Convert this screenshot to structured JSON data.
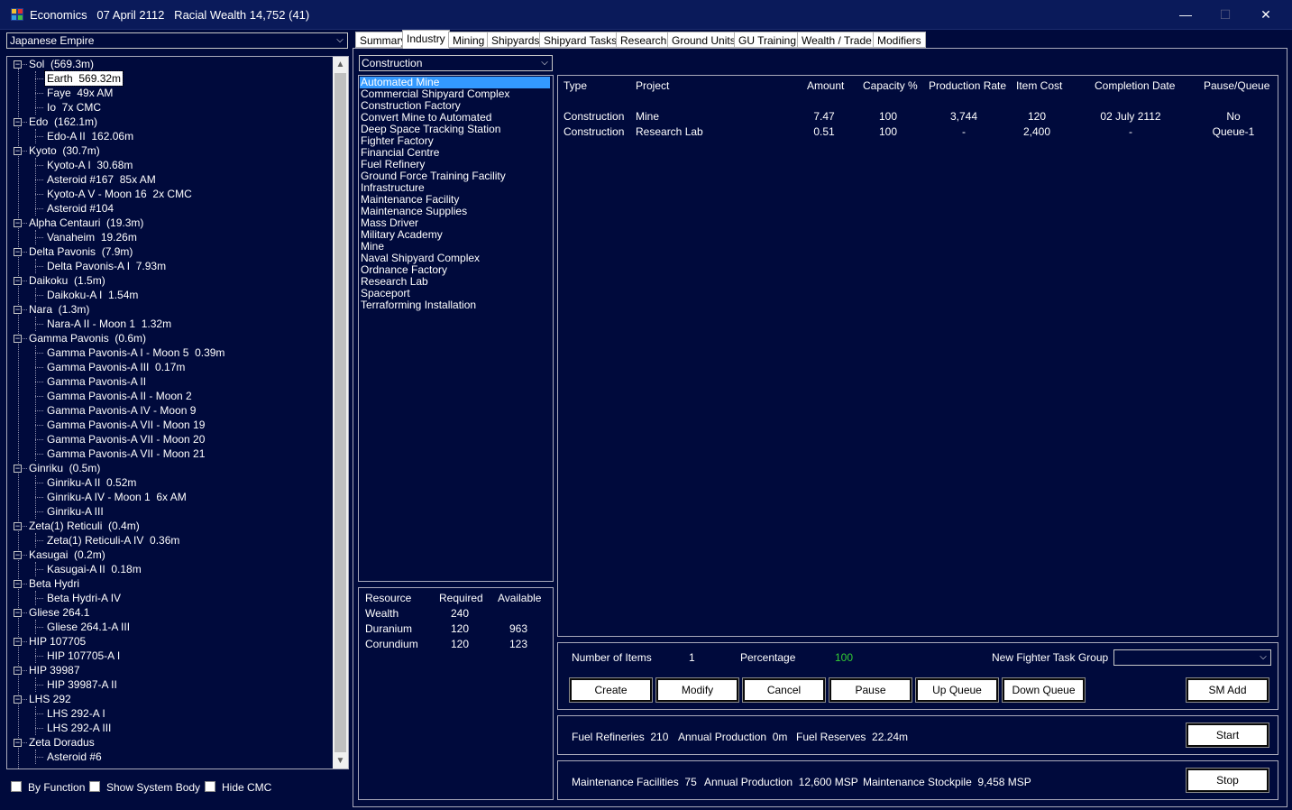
{
  "window": {
    "title": "Economics   07 April 2112   Racial Wealth 14,752 (41)",
    "minimize_glyph": "—",
    "maximize_glyph": "☐",
    "close_glyph": "✕"
  },
  "left": {
    "empire_select_value": "Japanese Empire",
    "tree": [
      {
        "label": "Sol  (569.3m)",
        "children": [
          "Earth  569.32m",
          "Faye  49x AM",
          "Io  7x CMC"
        ]
      },
      {
        "label": "Edo  (162.1m)",
        "children": [
          "Edo-A II  162.06m"
        ]
      },
      {
        "label": "Kyoto  (30.7m)",
        "children": [
          "Kyoto-A I  30.68m",
          "Asteroid #167  85x AM",
          "Kyoto-A V - Moon 16  2x CMC",
          "Asteroid #104"
        ]
      },
      {
        "label": "Alpha Centauri  (19.3m)",
        "children": [
          "Vanaheim  19.26m"
        ]
      },
      {
        "label": "Delta Pavonis  (7.9m)",
        "children": [
          "Delta Pavonis-A I  7.93m"
        ]
      },
      {
        "label": "Daikoku  (1.5m)",
        "children": [
          "Daikoku-A I  1.54m"
        ]
      },
      {
        "label": "Nara  (1.3m)",
        "children": [
          "Nara-A II - Moon 1  1.32m"
        ]
      },
      {
        "label": "Gamma Pavonis  (0.6m)",
        "children": [
          "Gamma Pavonis-A I - Moon 5  0.39m",
          "Gamma Pavonis-A III  0.17m",
          "Gamma Pavonis-A II",
          "Gamma Pavonis-A II - Moon 2",
          "Gamma Pavonis-A IV - Moon 9",
          "Gamma Pavonis-A VII - Moon 19",
          "Gamma Pavonis-A VII - Moon 20",
          "Gamma Pavonis-A VII - Moon 21"
        ]
      },
      {
        "label": "Ginriku  (0.5m)",
        "children": [
          "Ginriku-A II  0.52m",
          "Ginriku-A IV - Moon 1  6x AM",
          "Ginriku-A III"
        ]
      },
      {
        "label": "Zeta(1) Reticuli  (0.4m)",
        "children": [
          "Zeta(1) Reticuli-A IV  0.36m"
        ]
      },
      {
        "label": "Kasugai  (0.2m)",
        "children": [
          "Kasugai-A II  0.18m"
        ]
      },
      {
        "label": "Beta Hydri",
        "children": [
          "Beta Hydri-A IV"
        ]
      },
      {
        "label": "Gliese 264.1",
        "children": [
          "Gliese 264.1-A III"
        ]
      },
      {
        "label": "HIP 107705",
        "children": [
          "HIP 107705-A I"
        ]
      },
      {
        "label": "HIP 39987",
        "children": [
          "HIP 39987-A II"
        ]
      },
      {
        "label": "LHS 292",
        "children": [
          "LHS 292-A I",
          "LHS 292-A III"
        ]
      },
      {
        "label": "Zeta Doradus",
        "children": [
          "Asteroid #6"
        ]
      }
    ],
    "selected_body": "Earth  569.32m",
    "checkboxes": [
      "By Function",
      "Show System Body",
      "Hide CMC"
    ]
  },
  "tabs": [
    "Summary",
    "Industry",
    "Mining",
    "Shipyards",
    "Shipyard Tasks",
    "Research",
    "Ground Units",
    "GU Training",
    "Wealth / Trade",
    "Modifiers"
  ],
  "active_tab": "Industry",
  "industry": {
    "construction_select_value": "Construction",
    "projects": [
      "Automated Mine",
      "Commercial Shipyard Complex",
      "Construction Factory",
      "Convert Mine to Automated",
      "Deep Space Tracking Station",
      "Fighter Factory",
      "Financial Centre",
      "Fuel Refinery",
      "Ground Force Training Facility",
      "Infrastructure",
      "Maintenance Facility",
      "Maintenance Supplies",
      "Mass Driver",
      "Military Academy",
      "Mine",
      "Naval Shipyard Complex",
      "Ordnance Factory",
      "Research Lab",
      "Spaceport",
      "Terraforming Installation"
    ],
    "selected_project": "Automated Mine",
    "resources": {
      "headers": [
        "Resource",
        "Required",
        "Available"
      ],
      "rows": [
        [
          "Wealth",
          "240",
          ""
        ],
        [
          "Duranium",
          "120",
          "963"
        ],
        [
          "Corundium",
          "120",
          "123"
        ]
      ]
    },
    "queue": {
      "headers": [
        "Type",
        "Project",
        "Amount",
        "Capacity %",
        "Production Rate",
        "Item Cost",
        "Completion Date",
        "Pause/Queue"
      ],
      "rows": [
        [
          "Construction",
          "Mine",
          "7.47",
          "100",
          "3,744",
          "120",
          "02 July 2112",
          "No"
        ],
        [
          "Construction",
          "Research Lab",
          "0.51",
          "100",
          "-",
          "2,400",
          "-",
          "Queue-1"
        ]
      ]
    },
    "controls": {
      "number_of_items_label": "Number of Items",
      "number_of_items_value": "1",
      "percentage_label": "Percentage",
      "percentage_value": "100",
      "percentage_color": "#33cc33",
      "new_fighter_tg_label": "New Fighter Task Group",
      "buttons": [
        "Create",
        "Modify",
        "Cancel",
        "Pause",
        "Up Queue",
        "Down Queue"
      ],
      "sm_add": "SM Add"
    },
    "fuel": {
      "refineries": "Fuel Refineries  210",
      "annual_production": "Annual Production  0m",
      "reserves": "Fuel Reserves  22.24m",
      "button": "Start"
    },
    "maintenance": {
      "facilities": "Maintenance Facilities  75",
      "annual_production": "Annual Production  12,600 MSP",
      "stockpile": "Maintenance Stockpile  9,458 MSP",
      "button": "Stop"
    }
  }
}
